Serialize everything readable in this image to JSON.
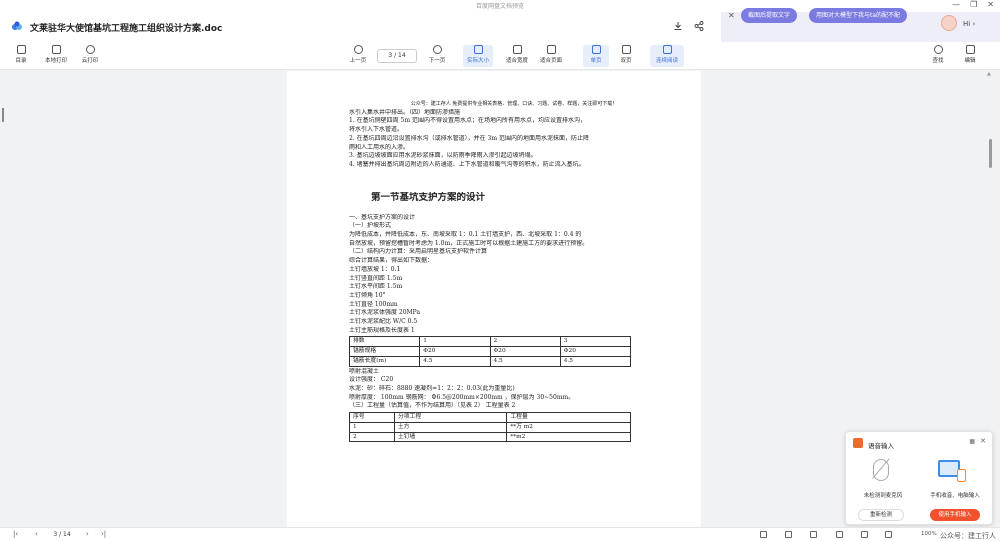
{
  "window": {
    "app_title": "百度网盘文档预览",
    "controls": [
      "—",
      "❐",
      "✕"
    ]
  },
  "header": {
    "doc_title": "文莱驻华大使馆基坑工程施工组织设计方案.doc",
    "ai_pill_1": "截图后提取文字",
    "ai_pill_2": "用图对大模型下我与ta的配不配",
    "greeting": "Hi",
    "greeting_arrow": "›",
    "download_icon": "download-icon",
    "share_icon": "share-icon"
  },
  "toolbar": {
    "catalog": "目录",
    "local_print": "本地打印",
    "cloud_print": "云打印",
    "prev_page": "上一页",
    "page_indicator": "3 / 14",
    "next_page": "下一页",
    "actual_size": "实际大小",
    "fit_width": "适合宽度",
    "fit_page": "适合页面",
    "single_page": "单页",
    "double_page": "双页",
    "continuous": "连续阅读",
    "find": "查找",
    "edit": "编辑"
  },
  "document": {
    "notice": "公众号：建工存人 免费提供专业相关表格、管理、口诀、习题、试卷、样题，关注即可下载！",
    "lines_top": [
      "水引入集水井中排出。（四）地面防渗措施",
      "1. 在基坑侧壁四周 5m 范围内不得设置用水点；在场地内所有用水点，均应设置排水沟，",
      "将水引入下水管道。",
      "2. 在基坑四周边沿设置排水沟（或排水管道），并在 3m 范围内的地面用水泥抹面，防止降",
      "雨和人工用水的入渗。",
      "3. 基坑边坡坡面应用水泥砂浆抹面，以防雨季降雨入渗引起边坡坍塌。",
      "4. 堵塞并排出基坑周边附近的人防通道、上下水管道和暖气沟等的积水，防止流入基坑。"
    ],
    "section_title": "第一节基坑支护方案的设计",
    "lines_mid": [
      "一、基坑支护方案的设计",
      "（一）护坡形式",
      "为降低成本，并降低成本，东、南坡采取 1：0.1 土钉墙支护，西、北坡采取 1：0.4 的",
      "自然放坡，预留挖槽暂时考虑为 1.0m，正式施工时可以根据土建施工方的要求进行预留。",
      "（二）结构内力计算：采用启明星基坑支护软件计算",
      "综合计算结果，得出如下数据：",
      "土钉墙放坡 1：0.1",
      "土钉竖直间距 1.5m",
      "土钉水平间距 1.5m",
      "土钉倾角 10°",
      "土钉直径 100mm",
      "土钉水泥浆体强度 20MPa",
      "土钉水泥浆配比 W/C 0.5",
      "土钉主筋规格及长度表 1"
    ],
    "table1": [
      [
        "排数",
        "1",
        "2",
        "3"
      ],
      [
        "锚筋规格",
        "Φ20",
        "Φ20",
        "Φ20"
      ],
      [
        "锚筋长度(m)",
        "4.5",
        "4.5",
        "4.5"
      ]
    ],
    "lines_after_t1": [
      "喷射混凝土",
      "设计强度： C20",
      "水泥：砂：碎石：8880 速凝剂=1：2：2：0.03(此为重量比)",
      "喷射厚度： 100mm 钢筋网： Φ6.5@200mm×200mm ，保护层为 30~50mm。",
      "（三）工程量（估算值，不作为结算用）（见表 2） 工程量表 2"
    ],
    "table2": [
      [
        "序号",
        "分项工程",
        "工程量"
      ],
      [
        "1",
        "土方",
        "**万 m2"
      ],
      [
        "2",
        "土钉墙",
        "**m2"
      ]
    ]
  },
  "voice_panel": {
    "title": "语音输入",
    "left_label": "未检测到麦克风",
    "right_label": "手机收音、电脑输入",
    "btn_retry": "重新检测",
    "btn_phone": "使用手机输入"
  },
  "status_bar": {
    "first": "|‹",
    "prev": "‹",
    "page": "3 / 14",
    "next": "›",
    "last": "›|",
    "zoom": "100%"
  },
  "watermark": "公众号：建工行人"
}
